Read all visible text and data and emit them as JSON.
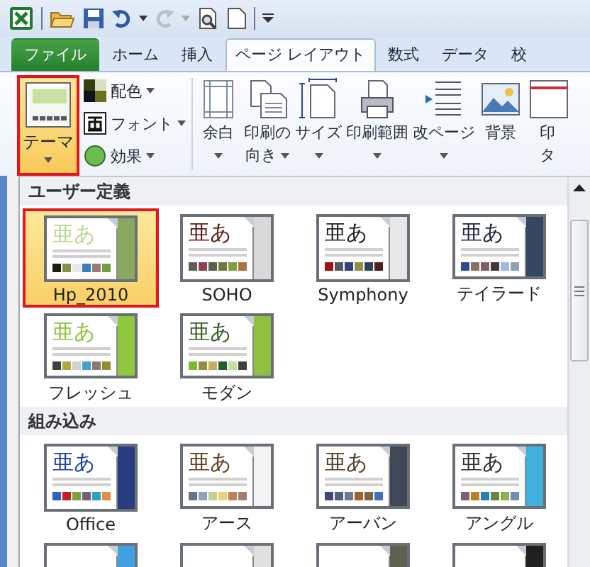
{
  "tabs": [
    {
      "label": "ファイル",
      "kind": "file",
      "selected": false
    },
    {
      "label": "ホーム",
      "kind": "tab",
      "selected": false
    },
    {
      "label": "挿入",
      "kind": "tab",
      "selected": false
    },
    {
      "label": "ページ レイアウト",
      "kind": "tab",
      "selected": true
    },
    {
      "label": "数式",
      "kind": "tab",
      "selected": false
    },
    {
      "label": "データ",
      "kind": "tab",
      "selected": false
    },
    {
      "label": "校",
      "kind": "tab",
      "selected": false
    }
  ],
  "ribbon": {
    "theme_button": {
      "label": "テーマ",
      "selected": true
    },
    "small_buttons": [
      {
        "label": "配色",
        "kind": "colors"
      },
      {
        "label": "フォント",
        "kind": "fonts"
      },
      {
        "label": "効果",
        "kind": "effects"
      }
    ],
    "big_buttons": [
      {
        "lines": [
          "余白"
        ],
        "dropdown": true,
        "kind": "margins"
      },
      {
        "lines": [
          "印刷の",
          "向き"
        ],
        "dropdown": true,
        "kind": "orientation"
      },
      {
        "lines": [
          "サイズ"
        ],
        "dropdown": true,
        "kind": "size"
      },
      {
        "lines": [
          "印刷範囲"
        ],
        "dropdown": true,
        "kind": "print_area"
      },
      {
        "lines": [
          "改ページ"
        ],
        "dropdown": true,
        "kind": "breaks"
      },
      {
        "lines": [
          "背景"
        ],
        "dropdown": false,
        "kind": "background"
      },
      {
        "lines": [
          "印",
          "タ"
        ],
        "dropdown": false,
        "kind": "titles"
      }
    ]
  },
  "gallery": {
    "sections": [
      {
        "title": "ユーザー定義",
        "items": [
          {
            "name": "Hp_2010",
            "sample": "亜あ",
            "selected": true,
            "color": "#8aa860"
          },
          {
            "name": "SOHO",
            "sample": "亜あ",
            "selected": false,
            "color": "#d8d8d8"
          },
          {
            "name": "Symphony",
            "sample": "亜あ",
            "selected": false,
            "color": "#e8e8e8"
          },
          {
            "name": "テイラード",
            "sample": "亜あ",
            "selected": false,
            "color": "#344660"
          },
          {
            "name": "フレッシュ",
            "sample": "亜あ",
            "selected": false,
            "color": "#90c840"
          },
          {
            "name": "モダン",
            "sample": "亜あ",
            "selected": false,
            "color": "#90c040"
          }
        ]
      },
      {
        "title": "組み込み",
        "items": [
          {
            "name": "Office",
            "sample": "亜あ",
            "selected": false,
            "color": "#283c80"
          },
          {
            "name": "アース",
            "sample": "亜あ",
            "selected": false,
            "color": "#f4f4f4"
          },
          {
            "name": "アーバン",
            "sample": "亜あ",
            "selected": false,
            "color": "#404858"
          },
          {
            "name": "アングル",
            "sample": "亜あ",
            "selected": false,
            "color": "#40b0e0"
          },
          {
            "selected": false,
            "color": "#40a0e0"
          },
          {
            "selected": false,
            "color": "#e0e0e0"
          },
          {
            "selected": false,
            "color": "#606050"
          },
          {
            "selected": false,
            "color": "#202020"
          }
        ]
      }
    ]
  }
}
